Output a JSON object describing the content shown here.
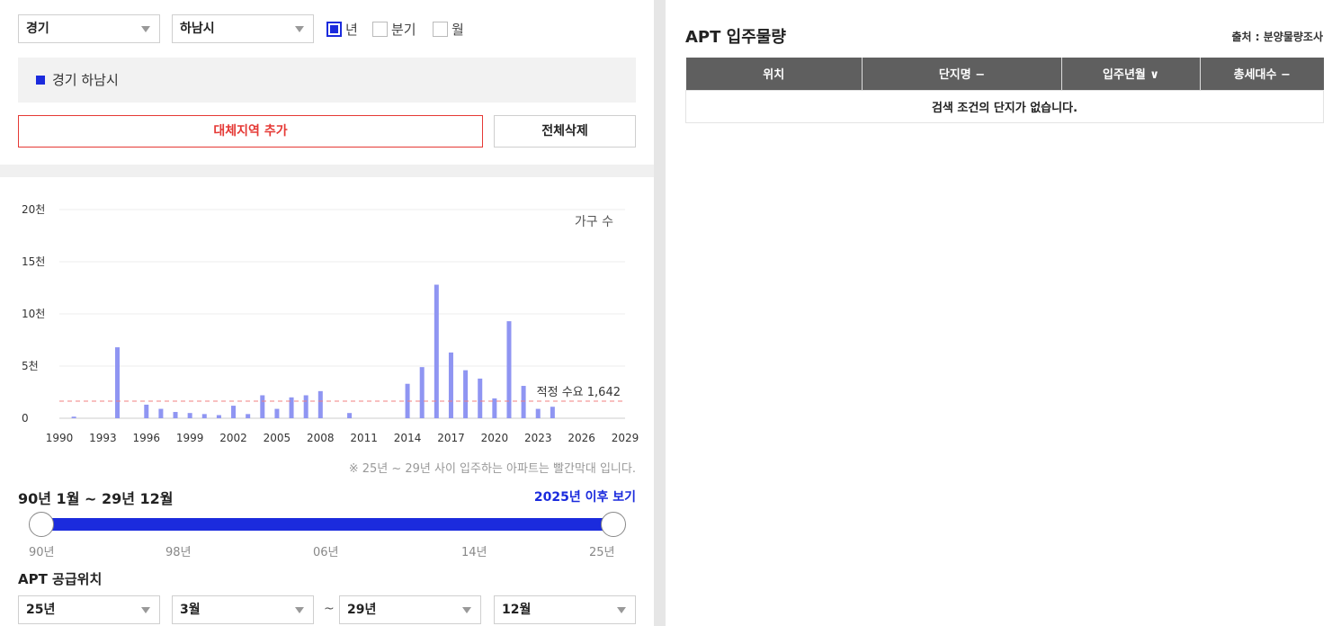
{
  "filters": {
    "province": "경기",
    "city": "하남시",
    "period_year": "년",
    "period_quarter": "분기",
    "period_month": "월"
  },
  "region_label": "경기 하남시",
  "buttons": {
    "add_region": "대체지역 추가",
    "delete_all": "전체삭제"
  },
  "colors": {
    "accent": "#1b2bdd",
    "bar": "#8f95f2",
    "demand_line": "#f08080",
    "alert": "#e53935"
  },
  "chart_data": {
    "type": "bar",
    "unit_label": "가구 수",
    "y_ticks": [
      "0",
      "5천",
      "10천",
      "15천",
      "20천"
    ],
    "ylim": [
      0,
      20000
    ],
    "x_ticks": [
      "1990",
      "1993",
      "1996",
      "1999",
      "2002",
      "2005",
      "2008",
      "2011",
      "2014",
      "2017",
      "2020",
      "2023",
      "2026",
      "2029"
    ],
    "x": [
      1991,
      1994,
      1996,
      1997,
      1998,
      1999,
      2000,
      2001,
      2002,
      2003,
      2004,
      2005,
      2006,
      2007,
      2008,
      2010,
      2014,
      2015,
      2016,
      2017,
      2018,
      2019,
      2020,
      2021,
      2022,
      2023,
      2024
    ],
    "values": [
      150,
      6800,
      1300,
      900,
      600,
      500,
      400,
      300,
      1200,
      400,
      2200,
      900,
      2000,
      2200,
      2600,
      500,
      3300,
      4900,
      12800,
      6300,
      4600,
      3800,
      1900,
      9300,
      3100,
      900,
      1100
    ],
    "demand_label": "적정 수요 1,642",
    "demand_value": 1642,
    "grid": true
  },
  "note": "※ 25년 ~ 29년 사이 입주하는 아파트는 빨간막대 입니다.",
  "range": {
    "title": "90년 1월 ~ 29년 12월",
    "link": "2025년 이후 보기",
    "ticks": [
      "90년",
      "98년",
      "06년",
      "14년",
      "25년"
    ]
  },
  "supply": {
    "title": "APT 공급위치",
    "from_year": "25년",
    "from_month": "3월",
    "separator": "~",
    "to_year": "29년",
    "to_month": "12월"
  },
  "panel": {
    "title": "APT 입주물량",
    "source": "출처 : 분양물량조사",
    "columns": [
      "위치",
      "단지명 −",
      "입주년월 ∨",
      "총세대수 −"
    ],
    "empty": "검색 조건의 단지가 없습니다."
  }
}
